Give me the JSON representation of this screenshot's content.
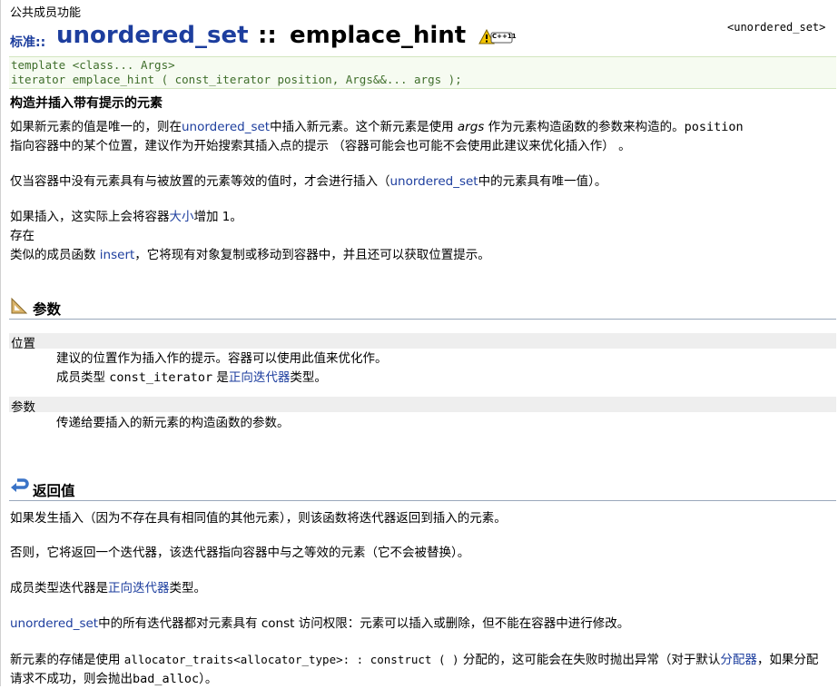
{
  "breadcrumb": "公共成员功能",
  "header": {
    "std_label": "标准::",
    "class_name": "unordered_set",
    "separator": "::",
    "method_name": "emplace_hint",
    "badge": "C++11",
    "ref": "<unordered_set>"
  },
  "prototype": {
    "line1": "template <class... Args>",
    "line2": "iterator emplace_hint ( const_iterator position, Args&&... args );"
  },
  "subtitle": "构造并插入带有提示的元素",
  "description": {
    "p1_a": "如果新元素的值是唯一的，则在",
    "p1_link": "unordered_set",
    "p1_b": "中插入新元素。这个新元素是使用 ",
    "p1_args": "args",
    "p1_c": " 作为元素构造函数的参数来构造的。",
    "p1_code": "position",
    "p1_line2": "指向容器中的某个位置，建议作为开始搜索其插入点的提示 （容器可能会也可能不会使用此建议来优化插入作） 。",
    "p2_a": "仅当容器中没有元素具有与被放置的元素等效的值时，才会进行插入（",
    "p2_link": "unordered_set",
    "p2_b": "中的元素具有唯一值）。",
    "p3_a": "如果插入，这实际上会将容器",
    "p3_link": "大小",
    "p3_b": "增加 1。",
    "p4": "存在",
    "p5_a": "类似的成员函数 ",
    "p5_link": "insert",
    "p5_b": "，它将现有对象复制或移动到容器中，并且还可以获取位置提示。"
  },
  "params_section": {
    "title": "参数",
    "icon": "ruler-triangle-icon",
    "items": [
      {
        "name": "位置",
        "desc1": "建议的位置作为插入作的提示。容器可以使用此值来优化作。",
        "desc2_a": "成员类型 ",
        "desc2_code": "const_iterator",
        "desc2_b": " 是",
        "desc2_link": "正向迭代器",
        "desc2_c": "类型。"
      },
      {
        "name": "参数",
        "desc1": "传递给要插入的新元素的构造函数的参数。"
      }
    ]
  },
  "return_section": {
    "title": "返回值",
    "icon": "return-arrow-icon",
    "r1": "如果发生插入（因为不存在具有相同值的其他元素），则该函数将迭代器返回到插入的元素。",
    "r2": "否则，它将返回一个迭代器，该迭代器指向容器中与之等效的元素（它不会被替换）。",
    "r3_a": "成员类型迭代器是",
    "r3_link": "正向迭代器",
    "r3_b": "类型。",
    "r4_link": "unordered_set",
    "r4_b": "中的所有迭代器都对元素具有 const 访问权限：元素可以插入或删除，但不能在容器中进行修改。",
    "r5_a": "新元素的存储是使用 ",
    "r5_code": "allocator_traits<allocator_type>: : construct ( )",
    "r5_b": " 分配的，这可能会在失败时抛出异常（对于默认",
    "r5_link": "分配器",
    "r5_c": "，如果分配请求不成功，则会抛出",
    "r5_code2": "bad_alloc",
    "r5_d": "）。"
  }
}
